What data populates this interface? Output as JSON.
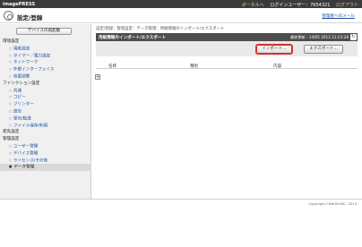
{
  "header": {
    "brand": "imagePRESS",
    "portal_link": "ポータルへ",
    "login_user_label": "ログインユーザー：",
    "login_user_value": "7654321",
    "logout": "ログアウト"
  },
  "titlebar": {
    "title": "設定/登録",
    "settings_link": "管理者へのメール"
  },
  "sidebar": {
    "restart_button": "デバイスの再起動",
    "menu": [
      {
        "type": "section",
        "label": "環境設定"
      },
      {
        "type": "item",
        "label": "用紙設定"
      },
      {
        "type": "item",
        "label": "タイマー／電力設定"
      },
      {
        "type": "item",
        "label": "ネットワーク"
      },
      {
        "type": "item",
        "label": "外部インターフェイス"
      },
      {
        "type": "item",
        "label": "音量調整"
      },
      {
        "type": "section",
        "label": "ファンクション設定"
      },
      {
        "type": "item",
        "label": "共通"
      },
      {
        "type": "item",
        "label": "コピー"
      },
      {
        "type": "item",
        "label": "プリンター"
      },
      {
        "type": "item",
        "label": "送信"
      },
      {
        "type": "item",
        "label": "受信/転送"
      },
      {
        "type": "item",
        "label": "ファイル保存/利用"
      },
      {
        "type": "section",
        "label": "宛先設定"
      },
      {
        "type": "section",
        "label": "管理設定"
      },
      {
        "type": "item",
        "label": "ユーザー管理"
      },
      {
        "type": "item",
        "label": "デバイス管理"
      },
      {
        "type": "item",
        "label": "ライセンス/その他"
      },
      {
        "type": "active",
        "label": "データ管理"
      }
    ]
  },
  "main": {
    "breadcrumb": "設定/登録：管理設定：データ管理：用紙情報のインポート/エクスポート",
    "panel_title": "用紙情報のインポート/エクスポート",
    "last_update": "最終更新 : 14/05 2013 12:23:28",
    "import_button": "インポート...",
    "export_button": "エクスポート...",
    "columns": [
      "名称",
      "種別",
      "内容"
    ],
    "expand_symbol": "+"
  },
  "footer": {
    "copyright": "Copyright CANON INC. 2013"
  }
}
